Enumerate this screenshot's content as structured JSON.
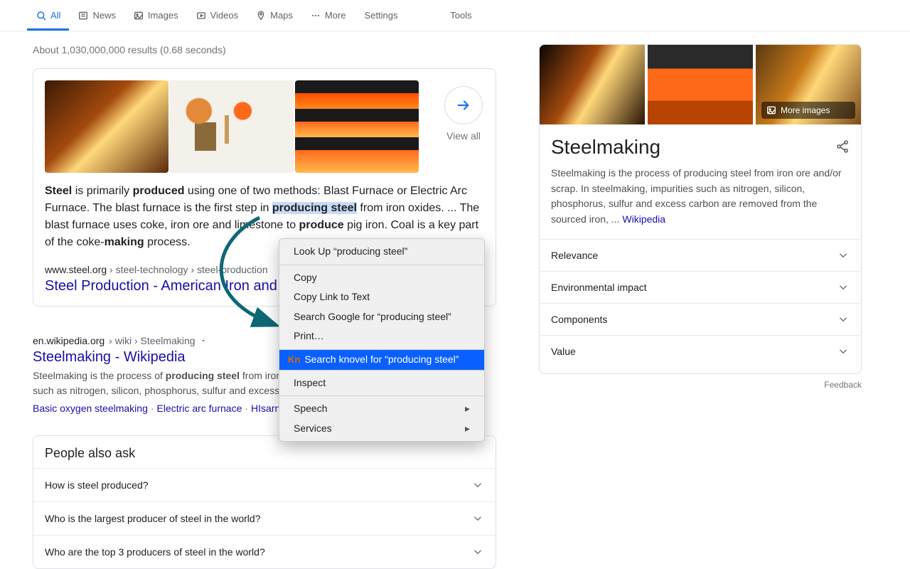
{
  "tabs": {
    "all": "All",
    "news": "News",
    "images": "Images",
    "videos": "Videos",
    "maps": "Maps",
    "more": "More",
    "settings": "Settings",
    "tools": "Tools"
  },
  "stats": "About 1,030,000,000 results (0.68 seconds)",
  "featured": {
    "view_all": "View all",
    "text_pre_bold1": "Steel",
    "text_seg1": " is primarily ",
    "text_bold2": "produced",
    "text_seg2": " using one of two methods: Blast Furnace or Electric Arc Furnace. The blast furnace is the first step in ",
    "text_hl": "producing steel",
    "text_seg3": " from iron oxides. ... The blast furnace uses coke, iron ore and limestone to ",
    "text_bold3": "produce",
    "text_seg4": " pig iron. Coal is a key part of the coke-",
    "text_bold4": "making",
    "text_seg5": " process.",
    "url_host": "www.steel.org",
    "url_path": " › steel-technology › steel-production",
    "title": "Steel Production - American Iron and"
  },
  "result2": {
    "url_host": "en.wikipedia.org",
    "url_path": " › wiki › Steelmaking",
    "title": "Steelmaking - Wikipedia",
    "desc_pre": "Steelmaking is the process of ",
    "desc_bold": "producing steel",
    "desc_post": " from iron ore and/or scrap. In steelmaking, impurities such as nitrogen, silicon, phosphorus, sulfur and excess ...",
    "links": [
      "Basic oxygen steelmaking",
      "Electric arc furnace",
      "HIsarna ironmaking process"
    ]
  },
  "paa": {
    "title": "People also ask",
    "items": [
      "How is steel produced?",
      "Who is the largest producer of steel in the world?",
      "Who are the top 3 producers of steel in the world?"
    ]
  },
  "kp": {
    "more_images": "More images",
    "title": "Steelmaking",
    "desc": "Steelmaking is the process of producing steel from iron ore and/or scrap. In steelmaking, impurities such as nitrogen, silicon, phosphorus, sulfur and excess carbon are removed from the sourced iron, ... ",
    "source": "Wikipedia",
    "rows": [
      "Relevance",
      "Environmental impact",
      "Components",
      "Value"
    ],
    "feedback": "Feedback"
  },
  "context_menu": {
    "lookup": "Look Up “producing steel”",
    "copy": "Copy",
    "copy_link": "Copy Link to Text",
    "search_google": "Search Google for “producing steel”",
    "print": "Print…",
    "search_knovel": "Search knovel for “producing steel”",
    "knovel_prefix": "Kn",
    "inspect": "Inspect",
    "speech": "Speech",
    "services": "Services"
  }
}
